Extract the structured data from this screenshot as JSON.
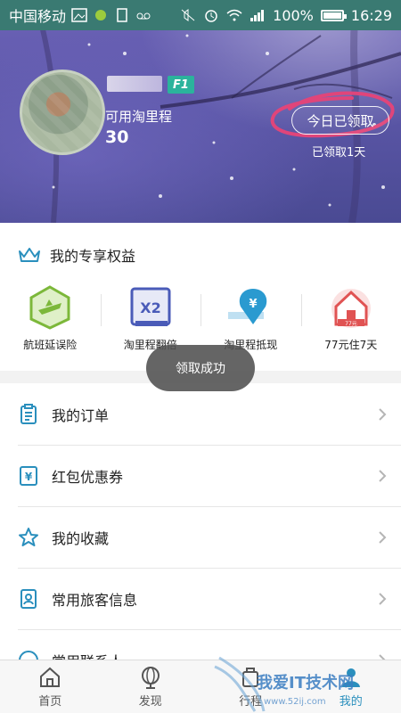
{
  "status_bar": {
    "carrier": "中国移动",
    "network": "4G",
    "battery": "100%",
    "time": "16:29"
  },
  "profile": {
    "level_badge": "F1",
    "mileage_label": "可用淘里程",
    "mileage_value": "30",
    "checkin_button": "今日已领取",
    "checkin_sub": "已领取1天"
  },
  "benefits": {
    "title": "我的专享权益",
    "items": [
      {
        "label": "航班延误险",
        "icon": "plane-badge-icon"
      },
      {
        "label": "淘里程翻倍",
        "icon": "x2-icon",
        "icon_text": "X2"
      },
      {
        "label": "淘里程抵现",
        "icon": "yen-pin-icon"
      },
      {
        "label": "77元住7天",
        "icon": "hotel-77-icon",
        "icon_text": "77元"
      }
    ]
  },
  "menu": {
    "items": [
      {
        "label": "我的订单",
        "icon": "order-list-icon"
      },
      {
        "label": "红包优惠券",
        "icon": "coupon-icon"
      },
      {
        "label": "我的收藏",
        "icon": "star-icon"
      },
      {
        "label": "常用旅客信息",
        "icon": "id-card-icon"
      },
      {
        "label": "常用联系人",
        "icon": "contact-icon"
      }
    ]
  },
  "toast": "领取成功",
  "tabs": [
    {
      "label": "首页",
      "icon": "home-icon"
    },
    {
      "label": "发现",
      "icon": "globe-icon"
    },
    {
      "label": "行程",
      "icon": "luggage-icon"
    },
    {
      "label": "我的",
      "icon": "user-icon",
      "active": true
    }
  ],
  "watermark": {
    "text": "我爱IT技术网",
    "url": "www.52ij.com"
  },
  "colors": {
    "accent": "#2bb39c",
    "icon_blue": "#2a8fbd",
    "status_bar": "#3a7a72"
  }
}
